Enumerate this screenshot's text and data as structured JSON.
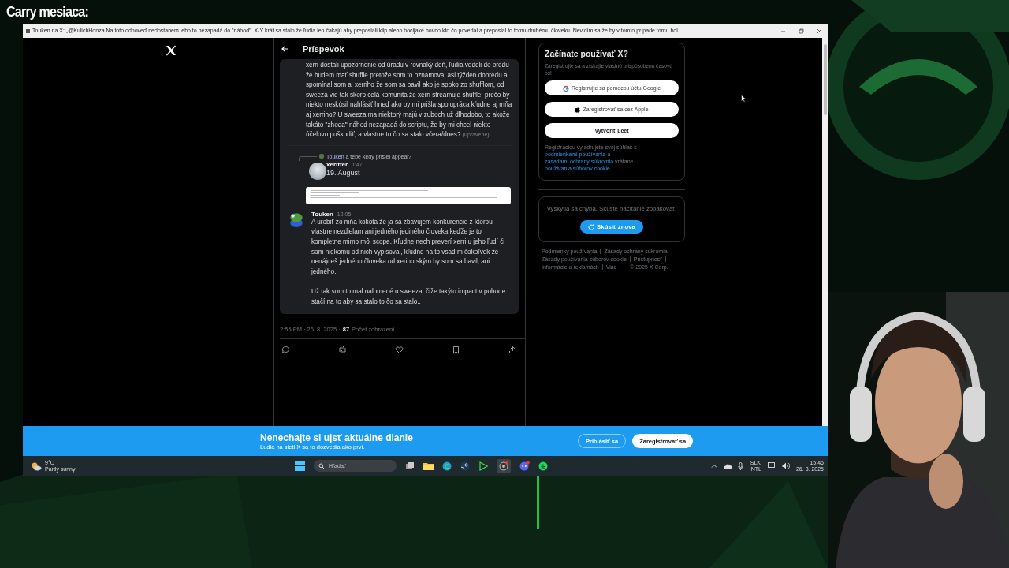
{
  "overlay": {
    "title": "Carry mesiaca:"
  },
  "browser": {
    "title": "Touken na X: „@KulichHonza Na toto odpoveď nedostanem lebo to nezapadá do \"náhod\". X-Y krát sa stalo že ľudia len čakajú aby preposlali klip alebo hocijaké hovno kto čo povedal a preposlal to tomu druhému človeku. Nevidím sa že by v tomto prípade tomu bol"
  },
  "post": {
    "header": "Príspevok",
    "messages": [
      {
        "kind": "continuation",
        "text": "xerri dostali upozornenie od úradu v rovnaký deň, ľudia vedeli do predu že budem mať shuffle pretože som to oznamoval asi týžden dopredu a spomínal som aj xerriho že som sa bavil ako je spoko zo shufflom, od sweeza vie tak skoro celá komunita že xerri streamuje shuffle, prečo by niekto neskúsil nahlásiť hneď ako by mi prišla spolupráca kľudne aj mňa aj xerriho? U sweeza ma niektorý majú v zuboch už dlhodobo, to akože takáto \"zhoda\" náhod nezapadá do scriptu, že by mi chcel niekto účelovo poškodiť, a vlastne to čo sa stalo včera/dnes?",
        "edited": "(upravené)"
      },
      {
        "kind": "reply",
        "reply_author": "Touken",
        "reply_text": "a tebe kedy prišiel appeal?",
        "author": "xeriffer",
        "time": "1:47",
        "paragraphs": [
          "19. August"
        ]
      },
      {
        "kind": "attachment"
      },
      {
        "kind": "message",
        "author": "Touken",
        "time": "12:05",
        "paragraphs": [
          "A urobiť zo mňa kokota že ja sa zbavujem konkurencie z ktorou vlastne nezdielam ani jedného jediného človeka keďže je to kompletne mimo môj scope. Kľudne nech preverí xerri u jeho ľudí či som niekomu od nich vypisoval, kľudne na to vsadím čokoľvek že nenájdeš jedného človeka od xeriho ským by som sa bavil, ani jedného.",
          "Už tak som to mal nalomené u sweeza, čiže takýto impact v pohode stačí na to aby sa stalo to čo sa stalo.."
        ]
      }
    ],
    "timestamp": "2:55 PM · 26. 8. 2025 ·",
    "views": "87",
    "views_label": "Počet zobrazení"
  },
  "signup": {
    "title": "Začínate používať X?",
    "subtitle": "Zaregistrujte sa a získajte vlastnú prispôsobenú časovú os!",
    "buttons": [
      {
        "kind": "google",
        "label": "Registrujte sa pomocou účtu Google"
      },
      {
        "kind": "apple",
        "label": "Zaregistrovať sa cez Apple"
      },
      {
        "kind": "create",
        "label": "Vytvoriť účet"
      }
    ],
    "terms": [
      {
        "text": "Registráciou vyjadrujete svoj súhlas s",
        "kind": "text"
      },
      {
        "text": "podmienkami používania",
        "kind": "link"
      },
      {
        "text": "a",
        "kind": "text"
      },
      {
        "text": "zásadami ochrany súkromia",
        "kind": "link"
      },
      {
        "text": "vrátane",
        "kind": "text"
      },
      {
        "text": "používania súborov cookie.",
        "kind": "link"
      }
    ]
  },
  "error": {
    "text": "Vyskytla sa chyba. Skúste načítanie zopakovať.",
    "retry": "Skúsiť znova"
  },
  "footer_links": [
    "Podmienky používania",
    "Zásady ochrany súkromia",
    "Zásady používania súborov cookie",
    "Prístupnosť",
    "Informácie o reklamách",
    "Viac ···",
    "© 2025 X Corp."
  ],
  "banner": {
    "title": "Nenechajte si ujsť aktuálne dianie",
    "subtitle": "Ľudia na sieti X sa to dozvedia ako prví.",
    "login": "Prihlásiť sa",
    "signup": "Zaregistrovať sa"
  },
  "taskbar": {
    "temperature": "9°C",
    "condition": "Partly sunny",
    "search_placeholder": "Hľadať",
    "language": "SLK",
    "layout": "INTL",
    "time": "15:46",
    "date": "26. 8. 2025"
  }
}
